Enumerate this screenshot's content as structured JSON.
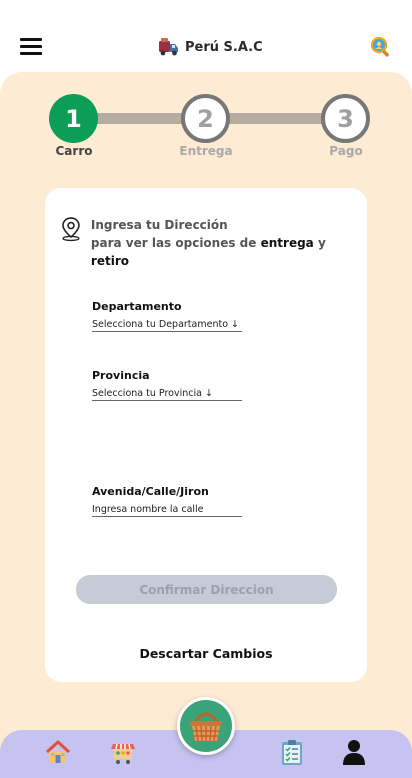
{
  "header": {
    "brand_title": "Perú S.A.C"
  },
  "steps": [
    {
      "number": "1",
      "label": "Carro",
      "state": "active"
    },
    {
      "number": "2",
      "label": "Entrega",
      "state": "inactive"
    },
    {
      "number": "3",
      "label": "Pago",
      "state": "inactive"
    }
  ],
  "address": {
    "prompt_line1": "Ingresa tu Dirección",
    "prompt_line2_pre": "para ver las opciones de",
    "prompt_bold1": "entrega",
    "prompt_y": "y",
    "prompt_bold2": "retiro"
  },
  "form": {
    "departamento_label": "Departamento",
    "departamento_value": "Selecciona tu Departamento ↓",
    "provincia_label": "Provincia",
    "provincia_value": "Selecciona tu Provincia ↓",
    "calle_label": "Avenida/Calle/Jiron",
    "calle_placeholder": "Ingresa nombre la calle"
  },
  "actions": {
    "confirm_label": "Confirmar Direccion",
    "discard_label": "Descartar Cambios"
  },
  "colors": {
    "accent_green": "#0c9d57",
    "background_peach": "#fdebd3",
    "nav_lavender": "#c6c3f1",
    "button_disabled": "#c7cbd6"
  },
  "icons": {
    "menu": "hamburger-menu-icon",
    "brand": "delivery-truck-icon",
    "search": "magnifier-icon",
    "location": "location-pin-icon",
    "home": "home-icon",
    "market": "market-stall-icon",
    "basket": "basket-icon",
    "orders": "clipboard-list-icon",
    "profile": "user-icon"
  }
}
